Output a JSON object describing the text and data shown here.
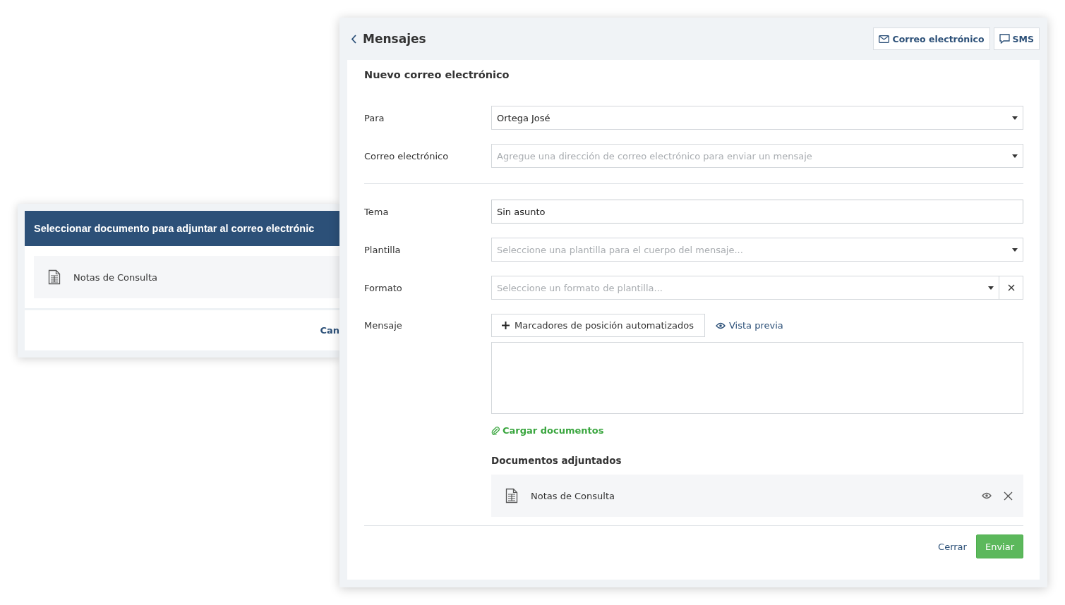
{
  "back_dialog": {
    "title": "Seleccionar documento para adjuntar al correo electrónic",
    "documents": [
      {
        "name": "Notas de Consulta"
      }
    ],
    "cancel_button": "Can"
  },
  "window": {
    "back_label": "Mensajes",
    "channel_buttons": [
      {
        "label": "Correo electrónico",
        "kind": "email"
      },
      {
        "label": "SMS",
        "kind": "sms"
      }
    ],
    "form_title": "Nuevo correo electrónico",
    "recipient_fields": [
      {
        "label": "Para",
        "kind": "select",
        "value": "Ortega José",
        "clearable": false
      },
      {
        "label": "Correo electrónico",
        "kind": "select",
        "placeholder": "Agregue una dirección de correo electrónico para enviar un mensaje",
        "clearable": false
      }
    ],
    "message_fields": [
      {
        "label": "Tema",
        "kind": "text",
        "value": "Sin asunto",
        "clearable": false
      },
      {
        "label": "Plantilla",
        "kind": "select",
        "placeholder": "Seleccione una plantilla para el cuerpo del mensaje...",
        "clearable": false
      },
      {
        "label": "Formato",
        "kind": "select",
        "placeholder": "Seleccione un formato de plantilla...",
        "clearable": true
      }
    ],
    "message": {
      "label": "Mensaje",
      "placeholders_button": "Marcadores de posición automatizados",
      "preview_link": "Vista previa"
    },
    "upload_link": "Cargar documentos",
    "attachments_title": "Documentos adjuntados",
    "attachments": [
      {
        "name": "Notas de Consulta"
      }
    ],
    "footer": {
      "close_link": "Cerrar",
      "send_button": "Enviar"
    }
  }
}
